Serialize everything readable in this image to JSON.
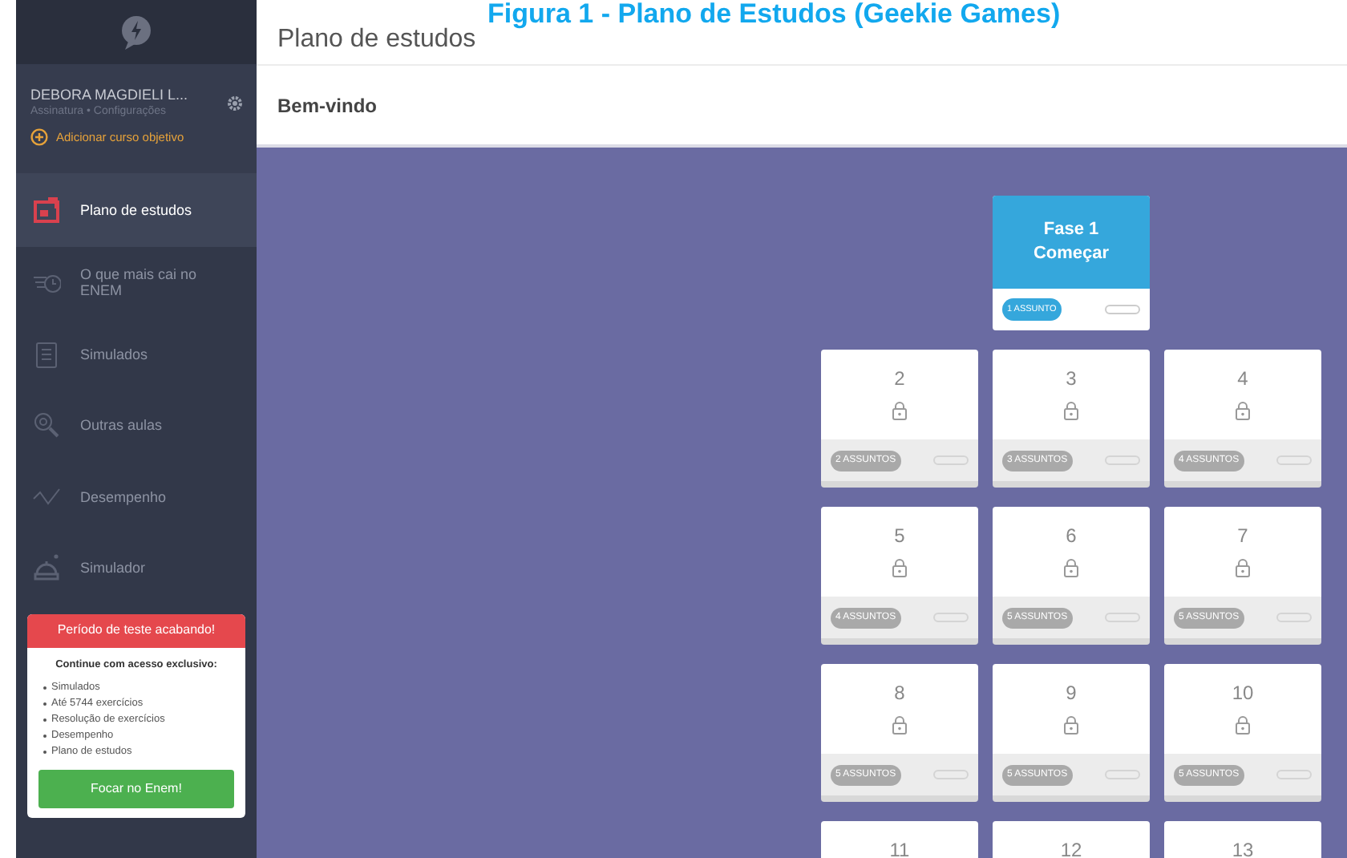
{
  "caption": "Figura 1 - Plano de Estudos (Geekie Games)",
  "sidebar": {
    "user_name": "DEBORA MAGDIELI L...",
    "user_links": "Assinatura • Configurações",
    "add_course": "Adicionar curso objetivo",
    "items": [
      {
        "label": "Plano de estudos",
        "selected": true
      },
      {
        "label": "O que mais cai no ENEM",
        "selected": false
      },
      {
        "label": "Simulados",
        "selected": false
      },
      {
        "label": "Outras aulas",
        "selected": false
      },
      {
        "label": "Desempenho",
        "selected": false
      },
      {
        "label": "Simulador",
        "selected": false
      }
    ]
  },
  "promo": {
    "title": "Período de teste acabando!",
    "subtitle": "Continue com acesso exclusivo:",
    "bullets": [
      "Simulados",
      "Até 5744 exercícios",
      "Resolução de exercícios",
      "Desempenho",
      "Plano de estudos"
    ],
    "button": "Focar no Enem!"
  },
  "header": {
    "title": "Plano de estudos"
  },
  "welcome": "Bem-vindo",
  "phases": [
    {
      "kind": "active",
      "title": "Fase 1",
      "action": "Começar",
      "count": "1 ASSUNTO"
    },
    {
      "kind": "locked",
      "number": "2",
      "count": "2 ASSUNTOS"
    },
    {
      "kind": "locked",
      "number": "3",
      "count": "3 ASSUNTOS"
    },
    {
      "kind": "locked",
      "number": "4",
      "count": "4 ASSUNTOS"
    },
    {
      "kind": "locked",
      "number": "5",
      "count": "4 ASSUNTOS"
    },
    {
      "kind": "locked",
      "number": "6",
      "count": "5 ASSUNTOS"
    },
    {
      "kind": "locked",
      "number": "7",
      "count": "5 ASSUNTOS"
    },
    {
      "kind": "locked",
      "number": "8",
      "count": "5 ASSUNTOS"
    },
    {
      "kind": "locked",
      "number": "9",
      "count": "5 ASSUNTOS"
    },
    {
      "kind": "locked",
      "number": "10",
      "count": "5 ASSUNTOS"
    },
    {
      "kind": "locked",
      "number": "11"
    },
    {
      "kind": "locked",
      "number": "12"
    },
    {
      "kind": "locked",
      "number": "13"
    }
  ]
}
